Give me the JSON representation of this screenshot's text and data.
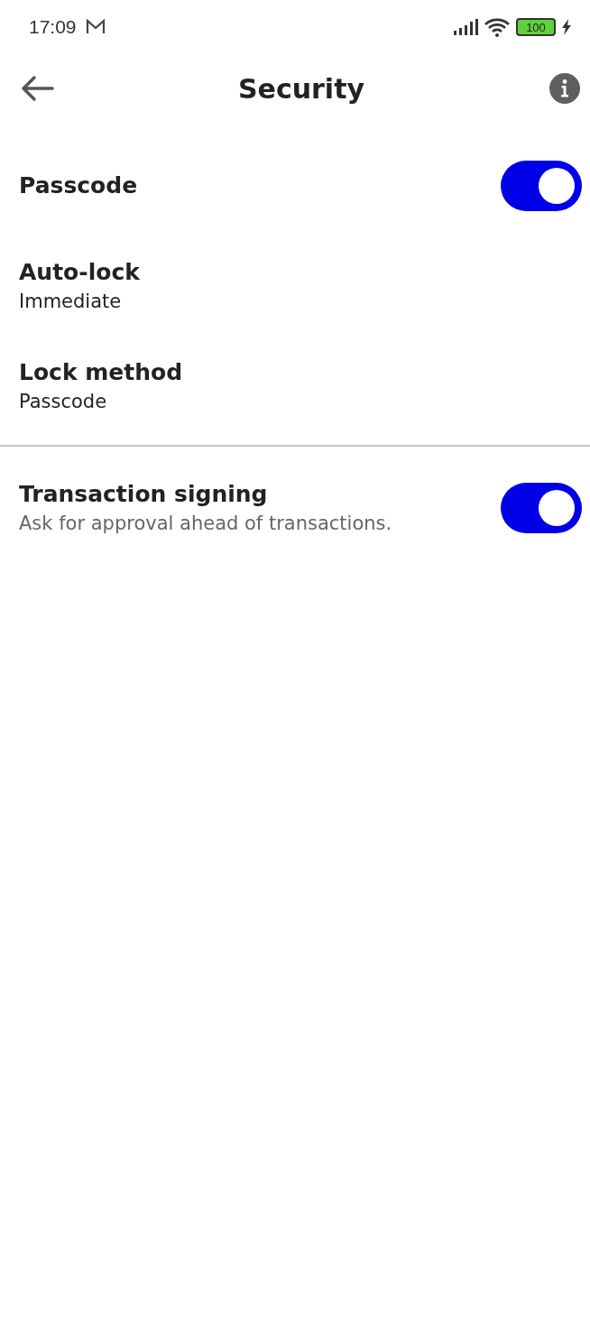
{
  "status_bar": {
    "time": "17:09",
    "battery": "100"
  },
  "header": {
    "title": "Security"
  },
  "groups": [
    {
      "items": [
        {
          "kind": "toggle",
          "title": "Passcode",
          "on": true
        },
        {
          "kind": "value",
          "title": "Auto-lock",
          "subtitle": "Immediate"
        },
        {
          "kind": "value",
          "title": "Lock method",
          "subtitle": "Passcode"
        }
      ]
    },
    {
      "items": [
        {
          "kind": "toggle",
          "title": "Transaction signing",
          "subtitle": "Ask for approval ahead of transactions.",
          "on": true
        }
      ]
    }
  ]
}
